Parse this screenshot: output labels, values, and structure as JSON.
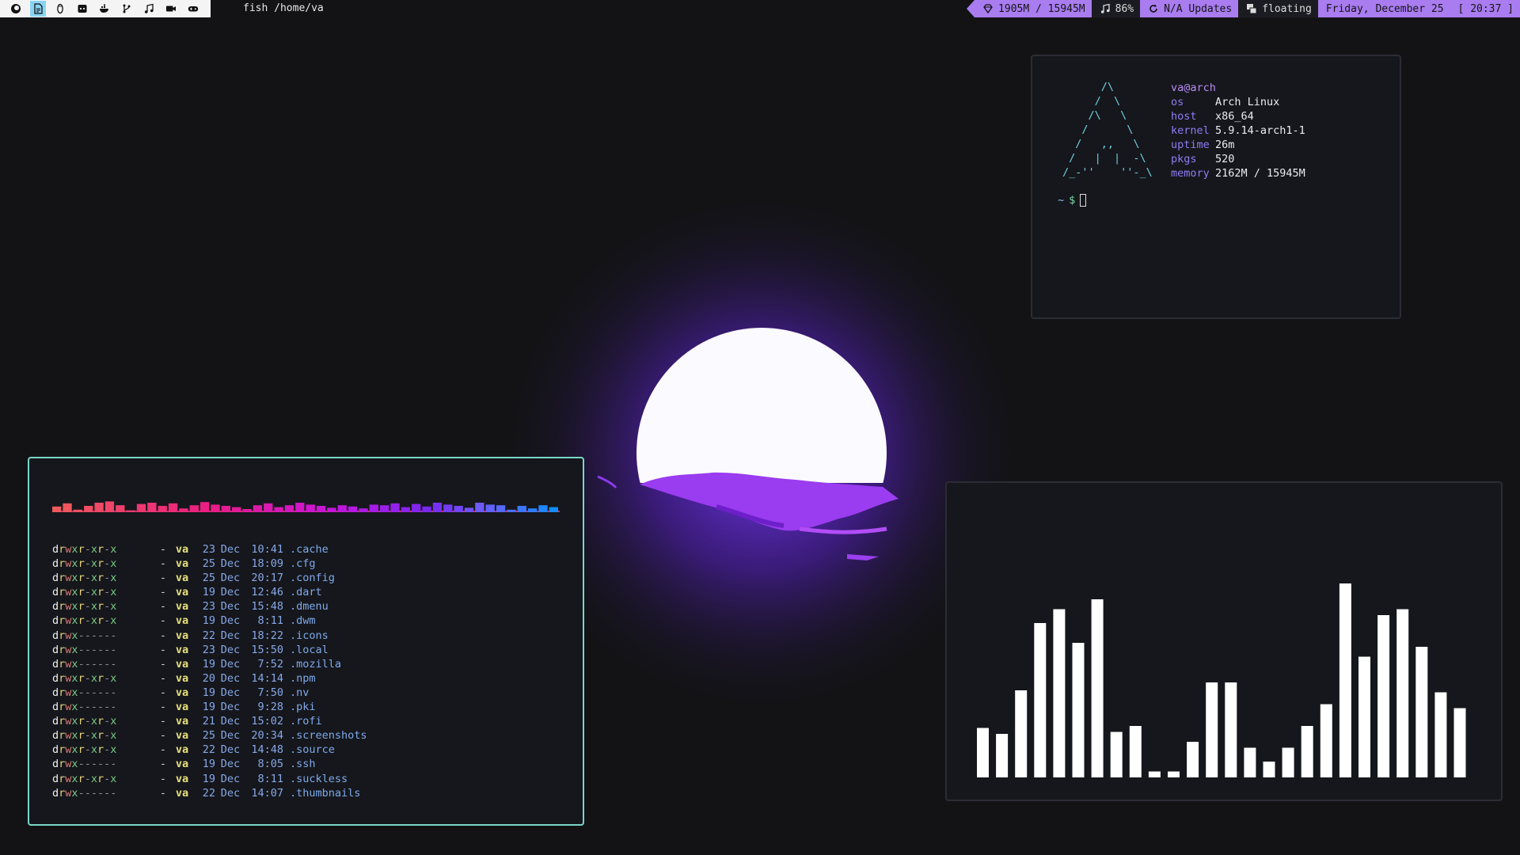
{
  "topbar": {
    "tag_icons": [
      "firefox-icon",
      "document-icon",
      "tux-icon",
      "discord-icon",
      "docker-icon",
      "git-branch-icon",
      "music-note-icon",
      "video-camera-icon",
      "gamepad-icon"
    ],
    "active_tag_index": 1,
    "window_title": "fish /home/va",
    "status": {
      "memory": "1905M / 15945M",
      "volume": "86%",
      "updates": "N/A Updates",
      "layout": "floating",
      "date": "Friday, December 25",
      "time": "[ 20:37 ]"
    },
    "colors": {
      "accent": "#a97cf0",
      "tags_bg": "#f4f4f4",
      "active_tag": "#8ad4f2"
    }
  },
  "neofetch": {
    "logo": [
      "      /\\",
      "     /  \\",
      "    /\\   \\",
      "   /      \\",
      "  /   ,,   \\",
      " /   |  |  -\\",
      "/_-''    ''-_\\"
    ],
    "user": "va@arch",
    "rows": [
      {
        "key": "os",
        "value": "Arch Linux"
      },
      {
        "key": "host",
        "value": "x86_64"
      },
      {
        "key": "kernel",
        "value": "5.9.14-arch1-1"
      },
      {
        "key": "uptime",
        "value": "26m"
      },
      {
        "key": "pkgs",
        "value": "520"
      },
      {
        "key": "memory",
        "value": "2162M / 15945M"
      }
    ],
    "prompt": {
      "tilde": "~",
      "symbol": "$"
    }
  },
  "files": {
    "spectrum_levels": [
      0.45,
      0.7,
      0.2,
      0.5,
      0.75,
      0.85,
      0.55,
      0.15,
      0.65,
      0.75,
      0.5,
      0.7,
      0.3,
      0.55,
      0.8,
      0.6,
      0.5,
      0.4,
      0.25,
      0.55,
      0.7,
      0.4,
      0.55,
      0.75,
      0.6,
      0.5,
      0.35,
      0.55,
      0.45,
      0.3,
      0.6,
      0.55,
      0.7,
      0.4,
      0.65,
      0.45,
      0.75,
      0.6,
      0.5,
      0.35,
      0.75,
      0.6,
      0.55,
      0.2,
      0.5,
      0.3,
      0.55,
      0.4
    ],
    "rows": [
      {
        "perm": "drwxr-xr-x",
        "user": "va",
        "day": "23",
        "month": "Dec",
        "time": "10:41",
        "name": ".cache"
      },
      {
        "perm": "drwxr-xr-x",
        "user": "va",
        "day": "25",
        "month": "Dec",
        "time": "18:09",
        "name": ".cfg"
      },
      {
        "perm": "drwxr-xr-x",
        "user": "va",
        "day": "25",
        "month": "Dec",
        "time": "20:17",
        "name": ".config"
      },
      {
        "perm": "drwxr-xr-x",
        "user": "va",
        "day": "19",
        "month": "Dec",
        "time": "12:46",
        "name": ".dart"
      },
      {
        "perm": "drwxr-xr-x",
        "user": "va",
        "day": "23",
        "month": "Dec",
        "time": "15:48",
        "name": ".dmenu"
      },
      {
        "perm": "drwxr-xr-x",
        "user": "va",
        "day": "19",
        "month": "Dec",
        "time": "8:11",
        "name": ".dwm"
      },
      {
        "perm": "drwx------",
        "user": "va",
        "day": "22",
        "month": "Dec",
        "time": "18:22",
        "name": ".icons"
      },
      {
        "perm": "drwx------",
        "user": "va",
        "day": "23",
        "month": "Dec",
        "time": "15:50",
        "name": ".local"
      },
      {
        "perm": "drwx------",
        "user": "va",
        "day": "19",
        "month": "Dec",
        "time": "7:52",
        "name": ".mozilla"
      },
      {
        "perm": "drwxr-xr-x",
        "user": "va",
        "day": "20",
        "month": "Dec",
        "time": "14:14",
        "name": ".npm"
      },
      {
        "perm": "drwx------",
        "user": "va",
        "day": "19",
        "month": "Dec",
        "time": "7:50",
        "name": ".nv"
      },
      {
        "perm": "drwx------",
        "user": "va",
        "day": "19",
        "month": "Dec",
        "time": "9:28",
        "name": ".pki"
      },
      {
        "perm": "drwxr-xr-x",
        "user": "va",
        "day": "21",
        "month": "Dec",
        "time": "15:02",
        "name": ".rofi"
      },
      {
        "perm": "drwxr-xr-x",
        "user": "va",
        "day": "25",
        "month": "Dec",
        "time": "20:34",
        "name": ".screenshots"
      },
      {
        "perm": "drwxr-xr-x",
        "user": "va",
        "day": "22",
        "month": "Dec",
        "time": "14:48",
        "name": ".source"
      },
      {
        "perm": "drwx------",
        "user": "va",
        "day": "19",
        "month": "Dec",
        "time": "8:05",
        "name": ".ssh"
      },
      {
        "perm": "drwxr-xr-x",
        "user": "va",
        "day": "19",
        "month": "Dec",
        "time": "8:11",
        "name": ".suckless"
      },
      {
        "perm": "drwx------",
        "user": "va",
        "day": "22",
        "month": "Dec",
        "time": "14:07",
        "name": ".thumbnails"
      }
    ]
  },
  "cava": {
    "levels": [
      0.25,
      0.22,
      0.44,
      0.78,
      0.85,
      0.68,
      0.9,
      0.23,
      0.26,
      0.03,
      0.03,
      0.18,
      0.48,
      0.48,
      0.15,
      0.08,
      0.15,
      0.26,
      0.37,
      0.98,
      0.61,
      0.82,
      0.85,
      0.66,
      0.43,
      0.35
    ],
    "color": "#ffffff"
  }
}
